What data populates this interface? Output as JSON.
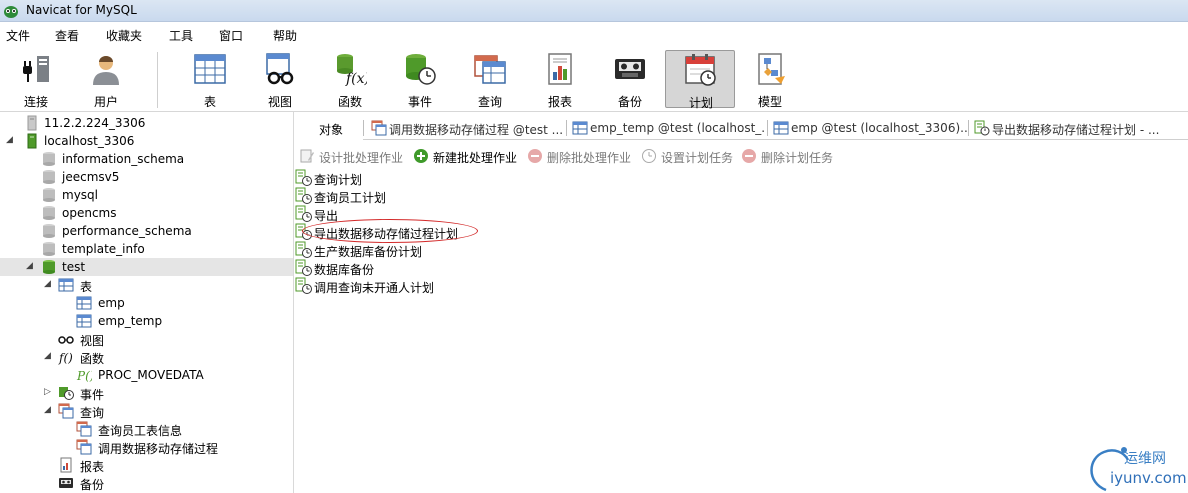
{
  "window": {
    "title": "Navicat for MySQL"
  },
  "menu": [
    "文件",
    "查看",
    "收藏夹",
    "工具",
    "窗口",
    "帮助"
  ],
  "toolbar": {
    "connect": "连接",
    "user": "用户",
    "table": "表",
    "view": "视图",
    "function": "函数",
    "event": "事件",
    "query": "查询",
    "report": "报表",
    "backup": "备份",
    "schedule": "计划",
    "model": "模型"
  },
  "sidebar": {
    "items": [
      {
        "label": "11.2.2.224_3306",
        "icon": "server-disconnected-icon"
      },
      {
        "label": "localhost_3306",
        "icon": "server-connected-icon"
      },
      {
        "label": "information_schema",
        "icon": "database-icon"
      },
      {
        "label": "jeecmsv5",
        "icon": "database-icon"
      },
      {
        "label": "mysql",
        "icon": "database-icon"
      },
      {
        "label": "opencms",
        "icon": "database-icon"
      },
      {
        "label": "performance_schema",
        "icon": "database-icon"
      },
      {
        "label": "template_info",
        "icon": "database-icon"
      },
      {
        "label": "test",
        "icon": "database-open-icon"
      },
      {
        "label": "表",
        "icon": "table-group-icon"
      },
      {
        "label": "emp",
        "icon": "table-icon"
      },
      {
        "label": "emp_temp",
        "icon": "table-icon"
      },
      {
        "label": "视图",
        "icon": "view-icon"
      },
      {
        "label": "函数",
        "icon": "function-icon"
      },
      {
        "label": "PROC_MOVEDATA",
        "icon": "procedure-icon"
      },
      {
        "label": "事件",
        "icon": "event-icon"
      },
      {
        "label": "查询",
        "icon": "query-group-icon"
      },
      {
        "label": "查询员工表信息",
        "icon": "query-icon"
      },
      {
        "label": "调用数据移动存储过程",
        "icon": "query-icon"
      },
      {
        "label": "报表",
        "icon": "report-icon"
      },
      {
        "label": "备份",
        "icon": "backup-icon"
      }
    ]
  },
  "tabs": [
    {
      "label": "对象"
    },
    {
      "label": "调用数据移动存储过程 @test ..."
    },
    {
      "label": "emp_temp @test (localhost_..."
    },
    {
      "label": "emp @test (localhost_3306)..."
    },
    {
      "label": "导出数据移动存储过程计划 - ..."
    }
  ],
  "actions": [
    {
      "label": "设计批处理作业",
      "enabled": false
    },
    {
      "label": "新建批处理作业",
      "enabled": true
    },
    {
      "label": "删除批处理作业",
      "enabled": false
    },
    {
      "label": "设置计划任务",
      "enabled": false
    },
    {
      "label": "删除计划任务",
      "enabled": false
    }
  ],
  "jobs": [
    "查询计划",
    "查询员工计划",
    "导出",
    "导出数据移动存储过程计划",
    "生产数据库备份计划",
    "数据库备份",
    "调用查询未开通人计划"
  ],
  "watermark": {
    "cn": "运维网",
    "en": "iyunv.com"
  },
  "colors": {
    "accent": "#2f6fb8",
    "highlight": "#d32a2a",
    "selected_row": "#e5e5e5",
    "active_tool": "#d6d6d6"
  }
}
